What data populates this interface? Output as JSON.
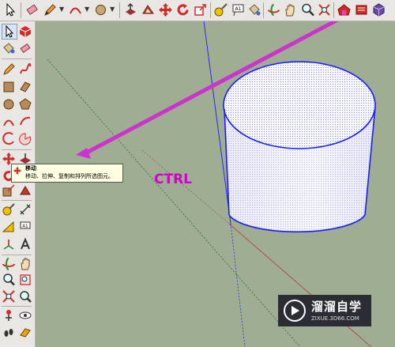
{
  "toolbar": {
    "items": [
      "select-icon",
      "eraser-icon",
      "pencil-icon",
      "arc-icon",
      "circle-icon",
      "push-pull-icon",
      "offset-icon",
      "move-icon",
      "rotate-icon",
      "scale-icon",
      "tape-measure-icon",
      "text-icon",
      "paint-bucket-icon",
      "orbit-icon",
      "pan-icon",
      "zoom-icon",
      "zoom-extents-icon",
      "warehouse-icon",
      "extension-icon",
      "component-icon"
    ]
  },
  "tooltip": {
    "title": "移动",
    "description": "移动、拉伸、复制和排列所选图元。"
  },
  "annotation": {
    "key_label": "CTRL",
    "color": "#d200cc"
  },
  "watermark": {
    "title": "溜溜自学",
    "url": "ZIXUE.3D66.COM"
  },
  "colors": {
    "canvas": "#9fae93",
    "toolbar": "#e9e7e3",
    "edge_blue": "#1a1aff",
    "arrow_magenta": "#cc33cc"
  }
}
